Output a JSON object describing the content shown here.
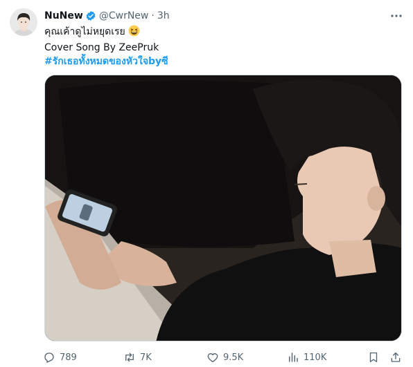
{
  "tweet": {
    "display_name": "NuNew",
    "handle": "@CwrNew",
    "separator": "·",
    "time": "3h",
    "lines": [
      "คุณเค้าดูไม่หยุดเรย",
      "Cover Song By ZeePruk"
    ],
    "emoji": "laughing-face",
    "hashtag": "#รักเธอทั้งหมดของหัวใจbyซี"
  },
  "icons": {
    "verified": "verified-badge-icon",
    "more": "more-dots-icon",
    "reply": "reply-icon",
    "retweet": "retweet-icon",
    "like": "heart-icon",
    "views": "views-bar-icon",
    "bookmark": "bookmark-icon",
    "share": "share-icon"
  },
  "actions": {
    "replies": "789",
    "reposts": "7K",
    "likes": "9.5K",
    "views": "110K"
  },
  "colors": {
    "accent": "#1d9bf0",
    "secondary_text": "#536471",
    "primary_text": "#0f1419"
  }
}
